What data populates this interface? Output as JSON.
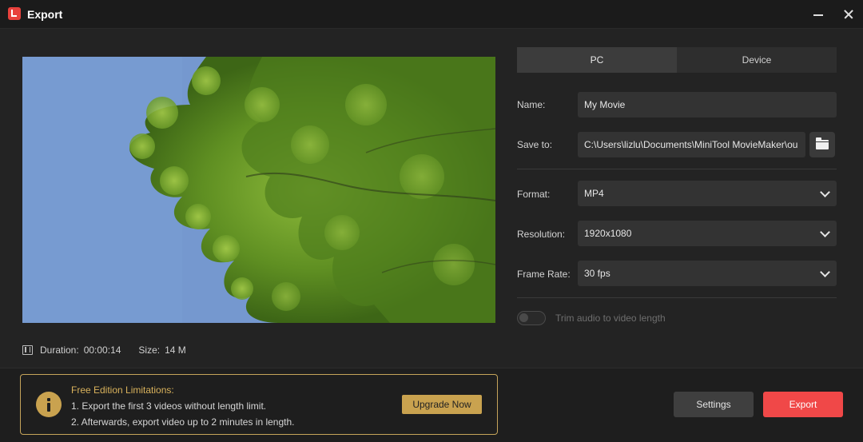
{
  "window": {
    "title": "Export",
    "icon": "minitool-logo-icon"
  },
  "preview": {
    "icon": "video-preview-tree-image"
  },
  "video_info": {
    "duration_label": "Duration:",
    "duration_value": "00:00:14",
    "size_label": "Size:",
    "size_value": "14 M"
  },
  "tabs": [
    {
      "label": "PC",
      "active": true
    },
    {
      "label": "Device",
      "active": false
    }
  ],
  "form": {
    "name_label": "Name:",
    "name_value": "My Movie",
    "save_label": "Save to:",
    "save_value": "C:\\Users\\lizlu\\Documents\\MiniTool MovieMaker\\ou",
    "format_label": "Format:",
    "format_value": "MP4",
    "resolution_label": "Resolution:",
    "resolution_value": "1920x1080",
    "framerate_label": "Frame Rate:",
    "framerate_value": "30 fps",
    "trim_label": "Trim audio to video length",
    "trim_enabled": false
  },
  "limitations": {
    "title": "Free Edition Limitations:",
    "line1": "1. Export the first 3 videos without length limit.",
    "line2": "2. Afterwards, export video up to 2 minutes in length.",
    "upgrade_label": "Upgrade Now"
  },
  "actions": {
    "settings_label": "Settings",
    "export_label": "Export"
  },
  "colors": {
    "accent": "#f04848",
    "gold": "#c9a24f",
    "background": "#232323"
  }
}
